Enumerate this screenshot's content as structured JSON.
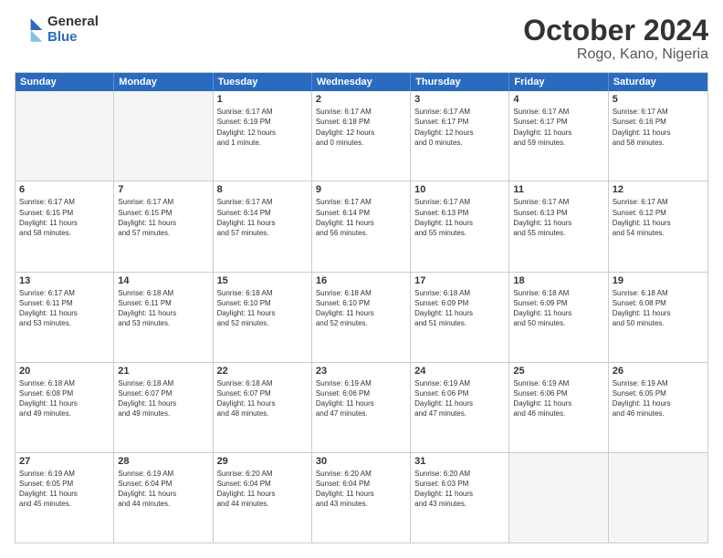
{
  "logo": {
    "general": "General",
    "blue": "Blue"
  },
  "title": "October 2024",
  "subtitle": "Rogo, Kano, Nigeria",
  "days": [
    "Sunday",
    "Monday",
    "Tuesday",
    "Wednesday",
    "Thursday",
    "Friday",
    "Saturday"
  ],
  "weeks": [
    [
      {
        "day": "",
        "content": ""
      },
      {
        "day": "",
        "content": ""
      },
      {
        "day": "1",
        "content": "Sunrise: 6:17 AM\nSunset: 6:19 PM\nDaylight: 12 hours\nand 1 minute."
      },
      {
        "day": "2",
        "content": "Sunrise: 6:17 AM\nSunset: 6:18 PM\nDaylight: 12 hours\nand 0 minutes."
      },
      {
        "day": "3",
        "content": "Sunrise: 6:17 AM\nSunset: 6:17 PM\nDaylight: 12 hours\nand 0 minutes."
      },
      {
        "day": "4",
        "content": "Sunrise: 6:17 AM\nSunset: 6:17 PM\nDaylight: 11 hours\nand 59 minutes."
      },
      {
        "day": "5",
        "content": "Sunrise: 6:17 AM\nSunset: 6:16 PM\nDaylight: 11 hours\nand 58 minutes."
      }
    ],
    [
      {
        "day": "6",
        "content": "Sunrise: 6:17 AM\nSunset: 6:15 PM\nDaylight: 11 hours\nand 58 minutes."
      },
      {
        "day": "7",
        "content": "Sunrise: 6:17 AM\nSunset: 6:15 PM\nDaylight: 11 hours\nand 57 minutes."
      },
      {
        "day": "8",
        "content": "Sunrise: 6:17 AM\nSunset: 6:14 PM\nDaylight: 11 hours\nand 57 minutes."
      },
      {
        "day": "9",
        "content": "Sunrise: 6:17 AM\nSunset: 6:14 PM\nDaylight: 11 hours\nand 56 minutes."
      },
      {
        "day": "10",
        "content": "Sunrise: 6:17 AM\nSunset: 6:13 PM\nDaylight: 11 hours\nand 55 minutes."
      },
      {
        "day": "11",
        "content": "Sunrise: 6:17 AM\nSunset: 6:13 PM\nDaylight: 11 hours\nand 55 minutes."
      },
      {
        "day": "12",
        "content": "Sunrise: 6:17 AM\nSunset: 6:12 PM\nDaylight: 11 hours\nand 54 minutes."
      }
    ],
    [
      {
        "day": "13",
        "content": "Sunrise: 6:17 AM\nSunset: 6:11 PM\nDaylight: 11 hours\nand 53 minutes."
      },
      {
        "day": "14",
        "content": "Sunrise: 6:18 AM\nSunset: 6:11 PM\nDaylight: 11 hours\nand 53 minutes."
      },
      {
        "day": "15",
        "content": "Sunrise: 6:18 AM\nSunset: 6:10 PM\nDaylight: 11 hours\nand 52 minutes."
      },
      {
        "day": "16",
        "content": "Sunrise: 6:18 AM\nSunset: 6:10 PM\nDaylight: 11 hours\nand 52 minutes."
      },
      {
        "day": "17",
        "content": "Sunrise: 6:18 AM\nSunset: 6:09 PM\nDaylight: 11 hours\nand 51 minutes."
      },
      {
        "day": "18",
        "content": "Sunrise: 6:18 AM\nSunset: 6:09 PM\nDaylight: 11 hours\nand 50 minutes."
      },
      {
        "day": "19",
        "content": "Sunrise: 6:18 AM\nSunset: 6:08 PM\nDaylight: 11 hours\nand 50 minutes."
      }
    ],
    [
      {
        "day": "20",
        "content": "Sunrise: 6:18 AM\nSunset: 6:08 PM\nDaylight: 11 hours\nand 49 minutes."
      },
      {
        "day": "21",
        "content": "Sunrise: 6:18 AM\nSunset: 6:07 PM\nDaylight: 11 hours\nand 49 minutes."
      },
      {
        "day": "22",
        "content": "Sunrise: 6:18 AM\nSunset: 6:07 PM\nDaylight: 11 hours\nand 48 minutes."
      },
      {
        "day": "23",
        "content": "Sunrise: 6:19 AM\nSunset: 6:06 PM\nDaylight: 11 hours\nand 47 minutes."
      },
      {
        "day": "24",
        "content": "Sunrise: 6:19 AM\nSunset: 6:06 PM\nDaylight: 11 hours\nand 47 minutes."
      },
      {
        "day": "25",
        "content": "Sunrise: 6:19 AM\nSunset: 6:06 PM\nDaylight: 11 hours\nand 46 minutes."
      },
      {
        "day": "26",
        "content": "Sunrise: 6:19 AM\nSunset: 6:05 PM\nDaylight: 11 hours\nand 46 minutes."
      }
    ],
    [
      {
        "day": "27",
        "content": "Sunrise: 6:19 AM\nSunset: 6:05 PM\nDaylight: 11 hours\nand 45 minutes."
      },
      {
        "day": "28",
        "content": "Sunrise: 6:19 AM\nSunset: 6:04 PM\nDaylight: 11 hours\nand 44 minutes."
      },
      {
        "day": "29",
        "content": "Sunrise: 6:20 AM\nSunset: 6:04 PM\nDaylight: 11 hours\nand 44 minutes."
      },
      {
        "day": "30",
        "content": "Sunrise: 6:20 AM\nSunset: 6:04 PM\nDaylight: 11 hours\nand 43 minutes."
      },
      {
        "day": "31",
        "content": "Sunrise: 6:20 AM\nSunset: 6:03 PM\nDaylight: 11 hours\nand 43 minutes."
      },
      {
        "day": "",
        "content": ""
      },
      {
        "day": "",
        "content": ""
      }
    ]
  ]
}
